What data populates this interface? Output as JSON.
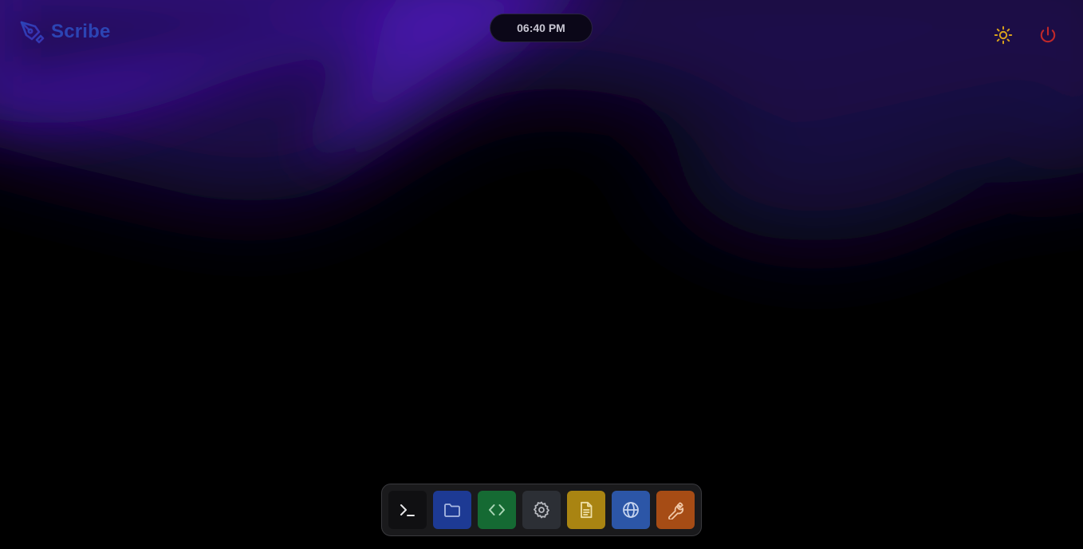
{
  "app": {
    "name": "Scribe",
    "brand_color": "#2c44b4"
  },
  "clock": {
    "time": "06:40 PM"
  },
  "header_controls": [
    {
      "name": "theme-toggle",
      "icon": "sun-icon",
      "color": "#d9a21c"
    },
    {
      "name": "power",
      "icon": "power-icon",
      "color": "#c0282a"
    }
  ],
  "dock": {
    "items": [
      {
        "app": "terminal",
        "icon": "terminal-icon",
        "color": "#101012"
      },
      {
        "app": "files",
        "icon": "folder-icon",
        "color": "#1d3a94"
      },
      {
        "app": "code-editor",
        "icon": "code-icon",
        "color": "#156a33"
      },
      {
        "app": "settings",
        "icon": "gear-icon",
        "color": "#2c2f35"
      },
      {
        "app": "notes",
        "icon": "document-icon",
        "color": "#a98412"
      },
      {
        "app": "browser",
        "icon": "globe-icon",
        "color": "#2c56a7"
      },
      {
        "app": "tools",
        "icon": "wrench-icon",
        "color": "#a64c15"
      }
    ]
  },
  "wallpaper": {
    "style": "aurora",
    "colors": [
      "#000000",
      "#3a0e8f",
      "#1a0c44"
    ]
  }
}
